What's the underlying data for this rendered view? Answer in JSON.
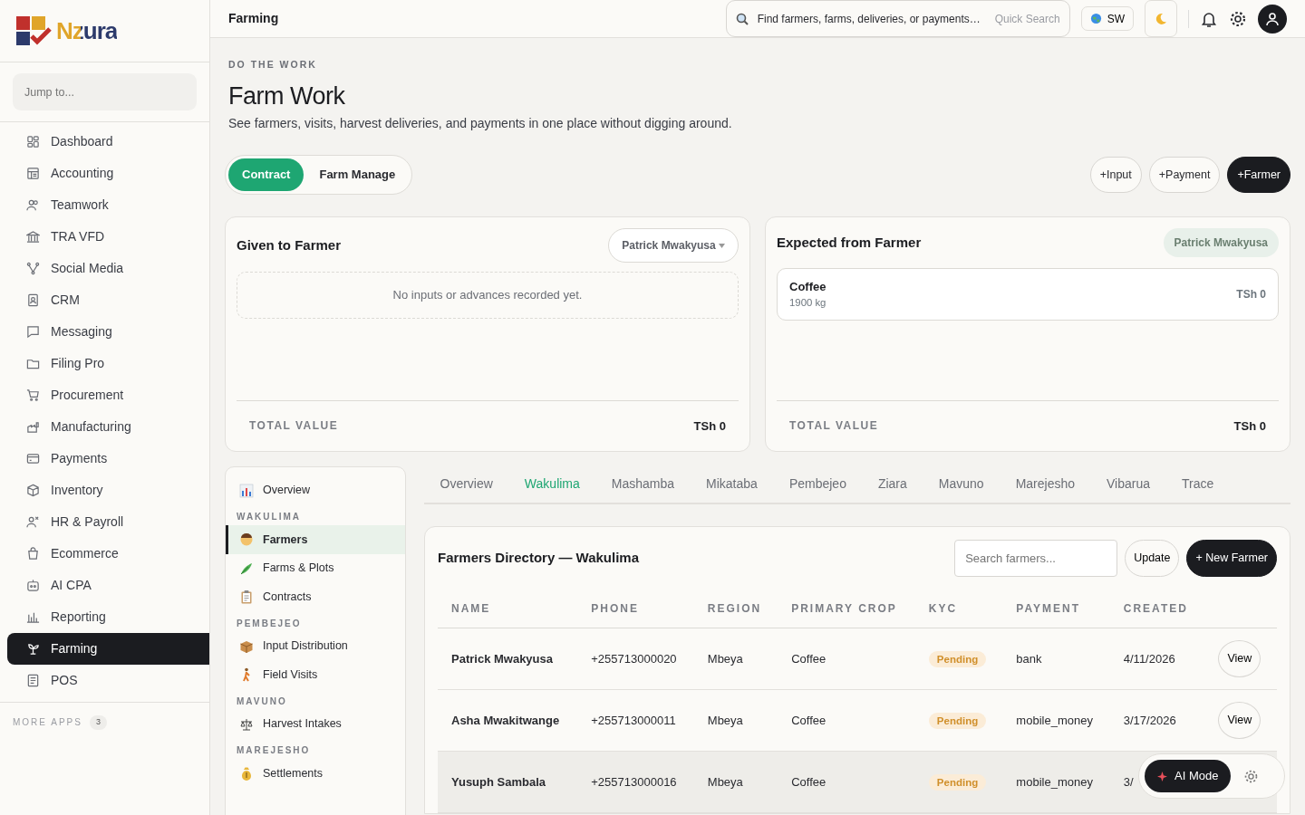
{
  "brand": {
    "name": "Nzura"
  },
  "sidebar": {
    "search": {
      "placeholder": "Jump to..."
    },
    "items": [
      {
        "label": "Dashboard",
        "selected": false
      },
      {
        "label": "Accounting",
        "selected": false
      },
      {
        "label": "Teamwork",
        "selected": false
      },
      {
        "label": "TRA VFD",
        "selected": false
      },
      {
        "label": "Social Media",
        "selected": false
      },
      {
        "label": "CRM",
        "selected": false
      },
      {
        "label": "Messaging",
        "selected": false
      },
      {
        "label": "Filing Pro",
        "selected": false
      },
      {
        "label": "Procurement",
        "selected": false
      },
      {
        "label": "Manufacturing",
        "selected": false
      },
      {
        "label": "Payments",
        "selected": false
      },
      {
        "label": "Inventory",
        "selected": false
      },
      {
        "label": "HR & Payroll",
        "selected": false
      },
      {
        "label": "Ecommerce",
        "selected": false
      },
      {
        "label": "AI CPA",
        "selected": false
      },
      {
        "label": "Reporting",
        "selected": false
      },
      {
        "label": "Farming",
        "selected": true
      },
      {
        "label": "POS",
        "selected": false
      }
    ],
    "more_apps": {
      "label": "MORE APPS",
      "count": "3"
    }
  },
  "topbar": {
    "title": "Farming",
    "search": {
      "placeholder": "Find farmers, farms, deliveries, or payments…",
      "hint": "Quick Search"
    },
    "language": "SW"
  },
  "page": {
    "eyebrow": "DO THE WORK",
    "title": "Farm Work",
    "subtitle": "See farmers, visits, harvest deliveries, and payments in one place without digging around."
  },
  "mode_tabs": [
    {
      "label": "Contract",
      "selected": true
    },
    {
      "label": "Farm Manage",
      "selected": false
    }
  ],
  "actions": [
    {
      "label": "+Input",
      "kind": "outline"
    },
    {
      "label": "+Payment",
      "kind": "outline"
    },
    {
      "label": "+Farmer",
      "kind": "primary"
    }
  ],
  "given_card": {
    "title": "Given to Farmer",
    "farmer_select": "Patrick Mwakyusa",
    "empty": "No inputs or advances recorded yet.",
    "total_label": "TOTAL VALUE",
    "total": "TSh 0"
  },
  "expected_card": {
    "title": "Expected from Farmer",
    "farmer": "Patrick Mwakyusa",
    "items": [
      {
        "name": "Coffee",
        "quantity": "1900 kg",
        "amount": "TSh 0"
      }
    ],
    "total_label": "TOTAL VALUE",
    "total": "TSh 0"
  },
  "subnav": [
    {
      "items": [
        {
          "label": "Overview",
          "selected": false
        }
      ]
    },
    {
      "heading": "WAKULIMA",
      "items": [
        {
          "label": "Farmers",
          "selected": true
        },
        {
          "label": "Farms & Plots",
          "selected": false
        },
        {
          "label": "Contracts",
          "selected": false
        }
      ]
    },
    {
      "heading": "PEMBEJEO",
      "items": [
        {
          "label": "Input Distribution",
          "selected": false
        },
        {
          "label": "Field Visits",
          "selected": false
        }
      ]
    },
    {
      "heading": "MAVUNO",
      "items": [
        {
          "label": "Harvest Intakes",
          "selected": false
        }
      ]
    },
    {
      "heading": "MAREJESHO",
      "items": [
        {
          "label": "Settlements",
          "selected": false
        }
      ]
    }
  ],
  "tabs": [
    {
      "label": "Overview",
      "selected": false
    },
    {
      "label": "Wakulima",
      "selected": true
    },
    {
      "label": "Mashamba",
      "selected": false
    },
    {
      "label": "Mikataba",
      "selected": false
    },
    {
      "label": "Pembejeo",
      "selected": false
    },
    {
      "label": "Ziara",
      "selected": false
    },
    {
      "label": "Mavuno",
      "selected": false
    },
    {
      "label": "Marejesho",
      "selected": false
    },
    {
      "label": "Vibarua",
      "selected": false
    },
    {
      "label": "Trace",
      "selected": false
    }
  ],
  "directory": {
    "title": "Farmers Directory — Wakulima",
    "search": {
      "placeholder": "Search farmers..."
    },
    "update": "Update",
    "new": "+ New Farmer",
    "columns": [
      "NAME",
      "PHONE",
      "REGION",
      "PRIMARY CROP",
      "KYC",
      "PAYMENT",
      "CREATED"
    ],
    "rows": [
      {
        "name": "Patrick Mwakyusa",
        "phone": "+255713000020",
        "region": "Mbeya",
        "crop": "Coffee",
        "kyc": "Pending",
        "payment": "bank",
        "created": "4/11/2026",
        "action": "View",
        "highlighted": false
      },
      {
        "name": "Asha Mwakitwange",
        "phone": "+255713000011",
        "region": "Mbeya",
        "crop": "Coffee",
        "kyc": "Pending",
        "payment": "mobile_money",
        "created": "3/17/2026",
        "action": "View",
        "highlighted": false
      },
      {
        "name": "Yusuph Sambala",
        "phone": "+255713000016",
        "region": "Mbeya",
        "crop": "Coffee",
        "kyc": "Pending",
        "payment": "mobile_money",
        "created": "3/",
        "highlighted": true
      }
    ]
  },
  "ai": {
    "label": "AI Mode"
  }
}
